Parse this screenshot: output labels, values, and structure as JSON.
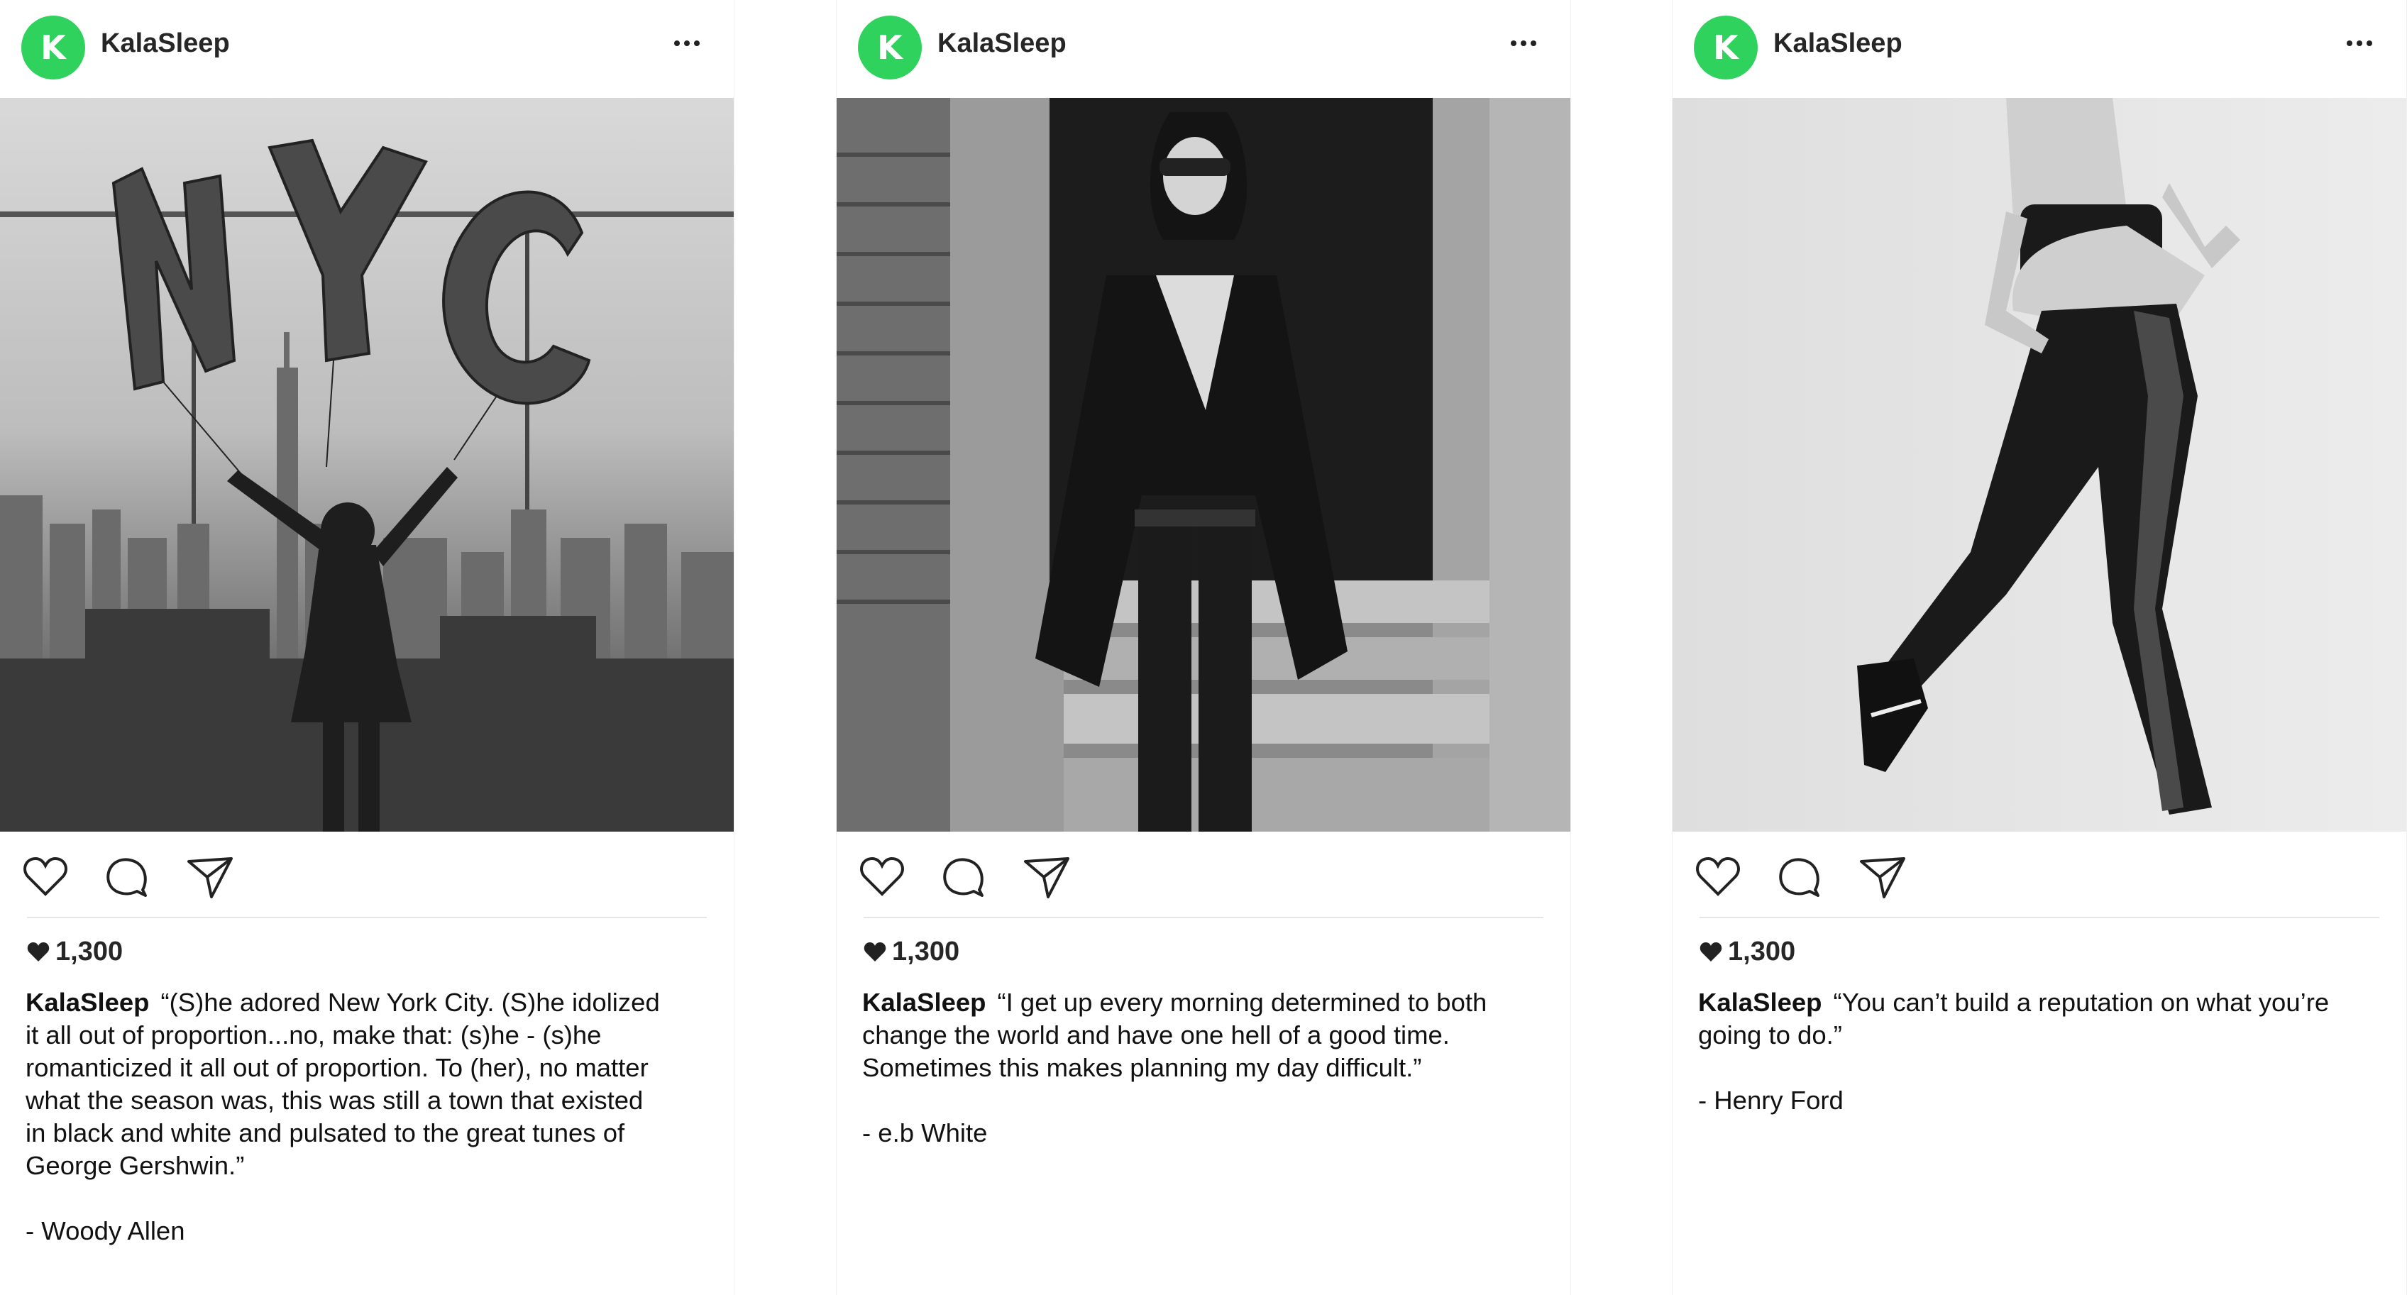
{
  "posts": [
    {
      "account": {
        "avatar_letter": "K",
        "username": "KalaSleep"
      },
      "likes": "1,300",
      "caption": {
        "username": "KalaSleep",
        "quote": "“(S)he adored New York City. (S)he idolized it all out of proportion...no, make that: (s)he - (s)he romanticized it all out of proportion. To (her), no matter what the season was, this was still a town that existed in black and white and pulsated to the great tunes of George Gershwin.”",
        "author": "- Woody Allen"
      },
      "image_text": "NYC"
    },
    {
      "account": {
        "avatar_letter": "K",
        "username": "KalaSleep"
      },
      "likes": "1,300",
      "caption": {
        "username": "KalaSleep",
        "quote": "“I get up every morning determined to both change the world and have one hell of a good time. Sometimes this makes planning my day difficult.”",
        "author": "- e.b White"
      }
    },
    {
      "account": {
        "avatar_letter": "K",
        "username": "KalaSleep"
      },
      "likes": "1,300",
      "caption": {
        "username": "KalaSleep",
        "quote": "“You can’t build a reputation on what you’re going to do.”",
        "author": "- Henry Ford"
      }
    }
  ],
  "colors": {
    "avatar_green": "#2fd25c",
    "text": "#111111",
    "divider": "#e6e6e6"
  },
  "icons": [
    "more-icon",
    "heart-icon",
    "comment-icon",
    "share-icon",
    "heart-small-icon"
  ]
}
